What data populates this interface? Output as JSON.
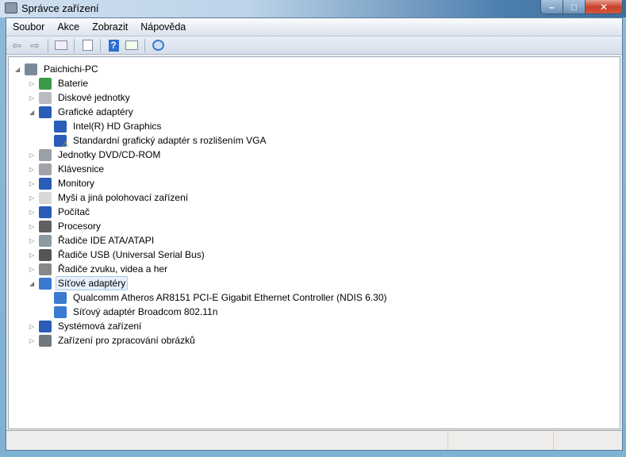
{
  "window": {
    "title": "Správce zařízení",
    "minimize": "–",
    "maximize": "□",
    "close": "✕"
  },
  "menu": [
    "Soubor",
    "Akce",
    "Zobrazit",
    "Nápověda"
  ],
  "toolbar": [
    "back-icon",
    "forward-icon",
    "show-hide-console-tree-icon",
    "properties-icon",
    "help-icon",
    "action-pane-icon",
    "scan-hardware-icon"
  ],
  "tree": [
    {
      "label": "Paichichi-PC",
      "level": 0,
      "expanded": true,
      "icon": "computer-icon",
      "color": "#7a8a9a"
    },
    {
      "label": "Baterie",
      "level": 1,
      "expanded": false,
      "icon": "battery-icon",
      "color": "#3a9a4a"
    },
    {
      "label": "Diskové jednotky",
      "level": 1,
      "expanded": false,
      "icon": "disk-drive-icon",
      "color": "#b8bcc0"
    },
    {
      "label": "Grafické adaptéry",
      "level": 1,
      "expanded": true,
      "icon": "display-adapter-icon",
      "color": "#2a5cb8"
    },
    {
      "label": "Intel(R) HD Graphics",
      "level": 2,
      "icon": "display-adapter-icon",
      "color": "#2a5cb8"
    },
    {
      "label": "Standardní grafický adaptér s rozlišením VGA",
      "level": 2,
      "icon": "display-adapter-warning-icon",
      "color": "#2a5cb8",
      "warning": true
    },
    {
      "label": "Jednotky DVD/CD-ROM",
      "level": 1,
      "expanded": false,
      "icon": "dvd-drive-icon",
      "color": "#9aa0a8"
    },
    {
      "label": "Klávesnice",
      "level": 1,
      "expanded": false,
      "icon": "keyboard-icon",
      "color": "#a0a4a8"
    },
    {
      "label": "Monitory",
      "level": 1,
      "expanded": false,
      "icon": "monitor-icon",
      "color": "#2a5cb8"
    },
    {
      "label": "Myši a jiná polohovací zařízení",
      "level": 1,
      "expanded": false,
      "icon": "mouse-icon",
      "color": "#d8d8d8"
    },
    {
      "label": "Počítač",
      "level": 1,
      "expanded": false,
      "icon": "computer-icon",
      "color": "#2a5cb8"
    },
    {
      "label": "Procesory",
      "level": 1,
      "expanded": false,
      "icon": "processor-icon",
      "color": "#606060"
    },
    {
      "label": "Řadiče IDE ATA/ATAPI",
      "level": 1,
      "expanded": false,
      "icon": "ide-controller-icon",
      "color": "#8a9aa0"
    },
    {
      "label": "Řadiče USB (Universal Serial Bus)",
      "level": 1,
      "expanded": false,
      "icon": "usb-icon",
      "color": "#555"
    },
    {
      "label": "Řadiče zvuku, videa a her",
      "level": 1,
      "expanded": false,
      "icon": "speaker-icon",
      "color": "#888"
    },
    {
      "label": "Síťové adaptéry",
      "level": 1,
      "expanded": true,
      "selected": true,
      "icon": "network-adapter-icon",
      "color": "#3a7ad0"
    },
    {
      "label": "Qualcomm Atheros AR8151 PCI-E Gigabit Ethernet Controller (NDIS 6.30)",
      "level": 2,
      "icon": "network-adapter-icon",
      "color": "#3a7ad0"
    },
    {
      "label": "Síťový adaptér Broadcom 802.11n",
      "level": 2,
      "icon": "network-adapter-icon",
      "color": "#3a7ad0"
    },
    {
      "label": "Systémová zařízení",
      "level": 1,
      "expanded": false,
      "icon": "system-devices-icon",
      "color": "#2a5cb8"
    },
    {
      "label": "Zařízení pro zpracování obrázků",
      "level": 1,
      "expanded": false,
      "icon": "imaging-device-icon",
      "color": "#707880"
    }
  ]
}
